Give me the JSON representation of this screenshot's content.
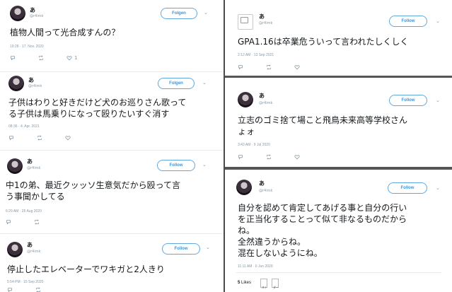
{
  "tweets": [
    {
      "name": "あ",
      "handle": "@r4imk",
      "follow": "Folgen",
      "text": [
        "植物人間って光合成すんの？"
      ],
      "time": "19:28 · 17. Nov. 2020",
      "likes": "1"
    },
    {
      "name": "あ",
      "handle": "@r4imk",
      "follow": "Folgen",
      "text": [
        "子供はわりと好きだけど犬のお巡りさん歌って",
        "る子供は馬乗りになって殴りたいすぐ消す"
      ],
      "time": "08:36 · 4. Apr. 2021"
    },
    {
      "name": "あ",
      "handle": "@r4imk",
      "follow": "Follow",
      "text": [
        "中1の弟、最近クッッソ生意気だから殴って言",
        "う事聞かしてる"
      ],
      "time": "6:29 AM · 25 Aug 2020"
    },
    {
      "name": "あ",
      "handle": "@r4imk",
      "follow": "Follow",
      "text": [
        "停止したエレベーターでワキガと2人きり"
      ],
      "time": "5:54 PM · 15 Sep 2020"
    },
    {
      "name": "あ",
      "handle": "@r4imk",
      "follow": "Follow",
      "text": [
        "GPA1.16は卒業危ういって言われたしくしく"
      ],
      "time": "2:12 AM · 13 Sep 2021"
    },
    {
      "name": "あ",
      "handle": "@r4imk",
      "follow": "Follow",
      "text": [
        "立志のゴミ捨て場こと飛鳥未来高等学校さん",
        "ょォ"
      ],
      "time": "3:43 AM · 9 Jul 2020"
    },
    {
      "name": "あ",
      "handle": "@r4imk",
      "follow": "Follow",
      "text": [
        "自分を認めて肯定してあげる事と自分の行い",
        "を正当化することって似て非なるものだから",
        "ね。",
        "全然違うからね。",
        "混在しないようにね。"
      ],
      "time": "11:11 AM · 6 Jun 2020",
      "likes_count": "5",
      "likes_label": "Likes",
      "liker_labels": [
        "ネト",
        "ダー"
      ]
    }
  ]
}
